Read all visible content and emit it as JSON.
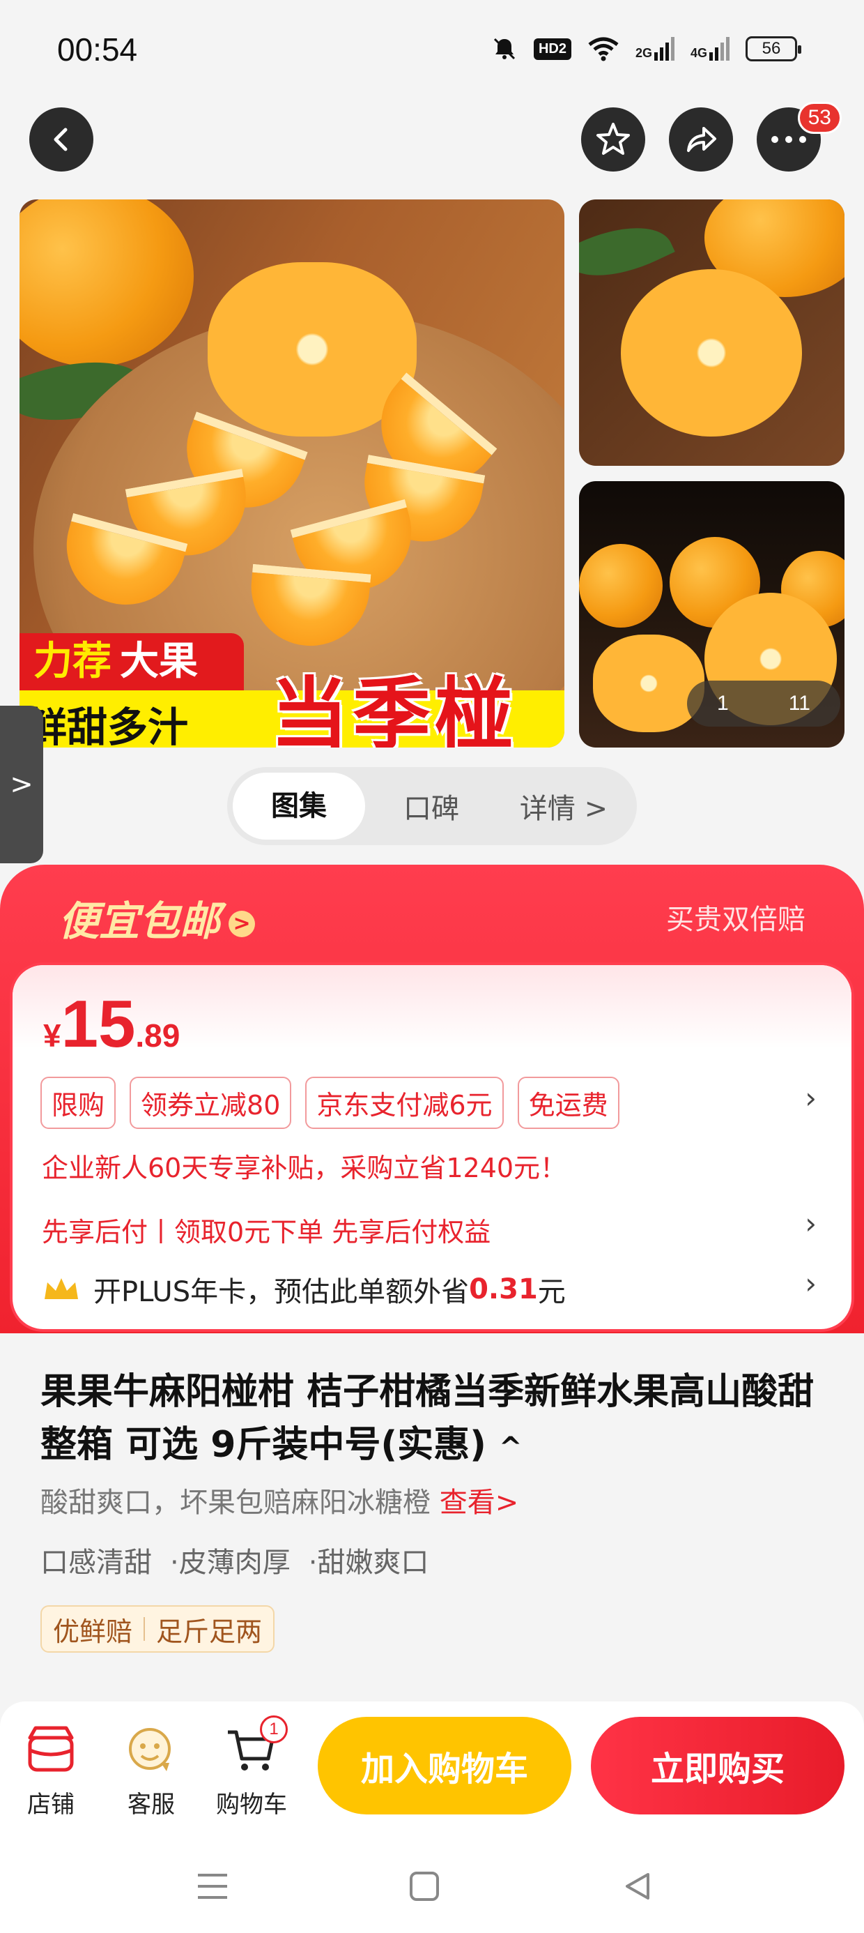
{
  "status_bar": {
    "time": "00:54",
    "hd_label": "HD2",
    "net1": "2G",
    "net2": "4G",
    "battery": "56"
  },
  "top_actions": {
    "more_badge": "53"
  },
  "gallery": {
    "promo_tag_1": "力荐",
    "promo_tag_2": "大果",
    "promo_strip": "鲜甜多汁",
    "promo_big": "当季椪柑",
    "counter_current": "1",
    "counter_total": "11"
  },
  "side_handle": {
    "glyph": ">"
  },
  "tabs": [
    {
      "label": "图集"
    },
    {
      "label": "口碑"
    },
    {
      "label": "详情 >"
    }
  ],
  "deal": {
    "title": "便宜包邮",
    "title_arrow": ">",
    "right_text": "买贵双倍赔",
    "price_currency": "¥",
    "price_int": "15",
    "price_dec": ".89",
    "tags": [
      "限购",
      "领券立减80",
      "京东支付减6元",
      "免运费"
    ],
    "subsidy": "企业新人60天专享补贴，采购立省1240元！",
    "pay_later": "先享后付丨领取0元下单 先享后付权益",
    "plus_prefix": "开PLUS年卡，预估此单额外省",
    "plus_amount": "0.31",
    "plus_suffix": "元",
    "chevron": "›"
  },
  "product": {
    "title": "果果牛麻阳椪柑 桔子柑橘当季新鲜水果高山酸甜整箱 可选 9斤装中号(实惠)",
    "title_toggle": "^",
    "desc": "酸甜爽口，坏果包赔麻阳冰糖橙",
    "desc_link": "查看>",
    "features": [
      "口感清甜",
      "·皮薄肉厚",
      "·甜嫩爽口"
    ],
    "guarantee_1": "优鲜赔",
    "guarantee_2": "足斤足两"
  },
  "bottom_bar": {
    "shop_label": "店铺",
    "service_label": "客服",
    "cart_label": "购物车",
    "cart_count": "1",
    "add_cart": "加入购物车",
    "buy_now": "立即购买"
  },
  "colors": {
    "accent_red": "#e8232d",
    "deal_bg": "#f0222e",
    "add_cart_yellow": "#ffc400",
    "gold": "#ffe9a6"
  }
}
